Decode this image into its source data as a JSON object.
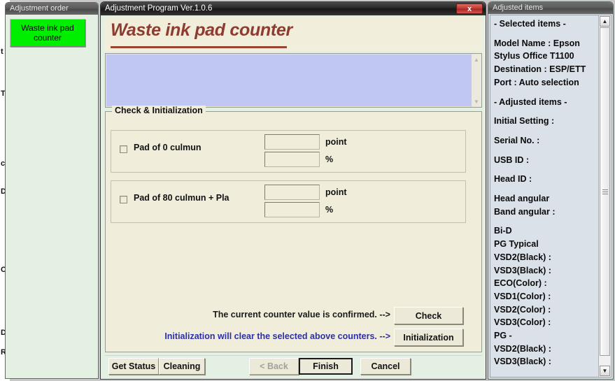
{
  "background_fragments": [
    "t",
    "T",
    "c",
    "D",
    "C",
    "D",
    "R"
  ],
  "left_panel": {
    "title": "Adjustment order",
    "button_label": "Waste ink pad counter"
  },
  "dialog": {
    "title": "Adjustment Program Ver.1.0.6",
    "close_label": "x",
    "heading": "Waste ink pad counter",
    "log_text": "",
    "groupbox_legend": "Check & Initialization",
    "pads": [
      {
        "label": "Pad  of  0 culmun",
        "point_value": "",
        "percent_value": "",
        "point_unit": "point",
        "percent_unit": "%",
        "checked": false
      },
      {
        "label": "Pad  of 80 culmun + Pla",
        "point_value": "",
        "percent_value": "",
        "point_unit": "point",
        "percent_unit": "%",
        "checked": false
      }
    ],
    "actions": [
      {
        "text": "The current counter value is confirmed. -->",
        "button": "Check"
      },
      {
        "text": "Initialization will clear the selected above counters. -->",
        "button": "Initialization"
      }
    ],
    "footer_buttons": {
      "get_status": "Get Status",
      "cleaning": "Cleaning",
      "back": "< Back",
      "finish": "Finish",
      "cancel": "Cancel"
    }
  },
  "right_panel": {
    "title": "Adjusted items",
    "lines": [
      "- Selected items -",
      "",
      "Model Name : Epson",
      "Stylus Office T1100",
      "Destination : ESP/ETT",
      "Port : Auto selection",
      "",
      "- Adjusted items -",
      "",
      "Initial Setting :",
      "",
      "Serial No. :",
      "",
      "USB ID :",
      "",
      "Head ID :",
      "",
      "Head angular",
      " Band angular :",
      "",
      "Bi-D",
      "PG Typical",
      " VSD2(Black) :",
      " VSD3(Black) :",
      " ECO(Color)  :",
      " VSD1(Color) :",
      " VSD2(Color) :",
      " VSD3(Color) :",
      "PG -",
      " VSD2(Black) :",
      " VSD3(Black) :"
    ],
    "scroll_up_icon": "▲",
    "scroll_down_icon": "▼"
  },
  "colors": {
    "accent_heading": "#8f3b2f",
    "selected_button": "#00ef00",
    "info_text": "#2c2fa8",
    "log_background": "#bfc7f2"
  }
}
